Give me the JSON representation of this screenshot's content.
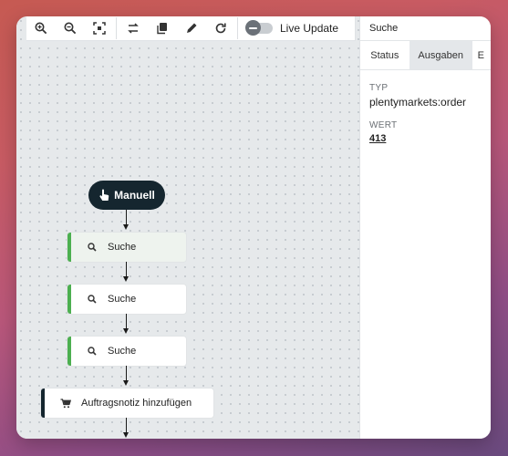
{
  "toolbar": {
    "live_update_label": "Live Update"
  },
  "workflow": {
    "start_label": "Manuell",
    "nodes": [
      {
        "label": "Suche",
        "icon": "search-icon"
      },
      {
        "label": "Suche",
        "icon": "search-icon"
      },
      {
        "label": "Suche",
        "icon": "search-icon"
      },
      {
        "label": "Auftragsnotiz hinzufügen",
        "icon": "cart-icon"
      }
    ]
  },
  "panel": {
    "title": "Suche",
    "tabs": [
      "Status",
      "Ausgaben",
      "E"
    ],
    "active_tab": "Ausgaben",
    "type_label": "TYP",
    "type_value": "plentymarkets:order",
    "value_label": "WERT",
    "value_value": "413"
  },
  "colors": {
    "accent_green": "#4caf50",
    "dark_node": "#15262f"
  }
}
